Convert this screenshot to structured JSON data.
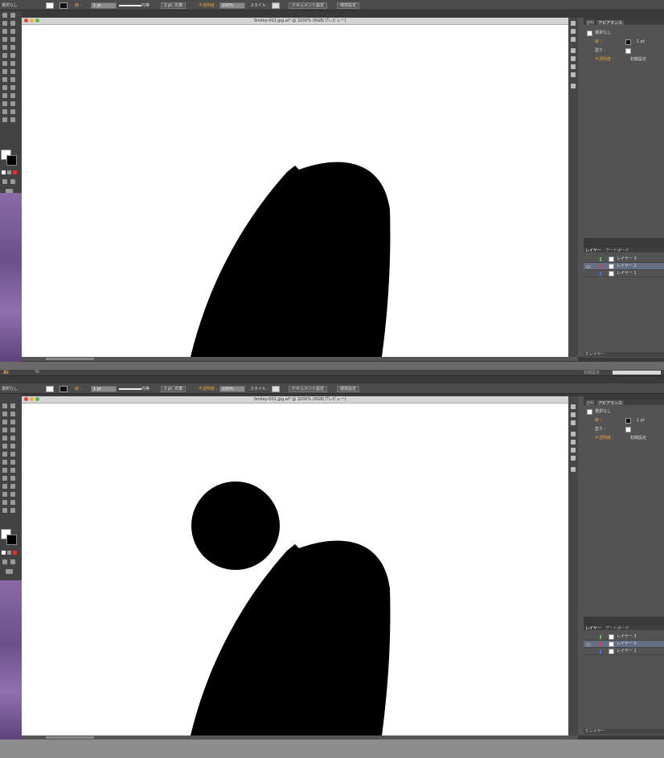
{
  "app": {
    "logo": "Ai",
    "bridge_label": "Br",
    "workspace": "初期設定"
  },
  "doc": {
    "title": "Smiley-001.jpg.ai* @ 3200% (RGB/プレビュー)"
  },
  "control_bar": {
    "selection": "選択なし",
    "stroke_label": "線 :",
    "stroke_weight": "1 pt",
    "profile": "均等",
    "brush": "3 pt. 丸筆",
    "opacity_label": "不透明度 :",
    "opacity_value": "100%",
    "style_label": "スタイル :",
    "document_setup": "ドキュメント設定",
    "preferences": "環境設定"
  },
  "appearance_panel": {
    "tabs": [
      "透明",
      "アピアランス"
    ],
    "header": "選択なし",
    "stroke_label": "線 :",
    "stroke_value": "1 pt",
    "fill_label": "塗り :",
    "opacity_label": "不透明度 :",
    "opacity_value": "初期設定"
  },
  "layers_panel": {
    "tabs": [
      "レイヤー",
      "アートボード"
    ],
    "layers": [
      {
        "name": "レイヤー 3",
        "color": "#4fc35a",
        "selected": false
      },
      {
        "name": "レイヤー 2",
        "color": "#e04040",
        "selected": true
      },
      {
        "name": "レイヤー 1",
        "color": "#4a6ee0",
        "selected": false
      }
    ],
    "count_label": "3 レイヤー"
  },
  "colors": {
    "canvas_bg": "#ffffff",
    "shape_fill": "#000000",
    "accent": "#e0a040"
  }
}
